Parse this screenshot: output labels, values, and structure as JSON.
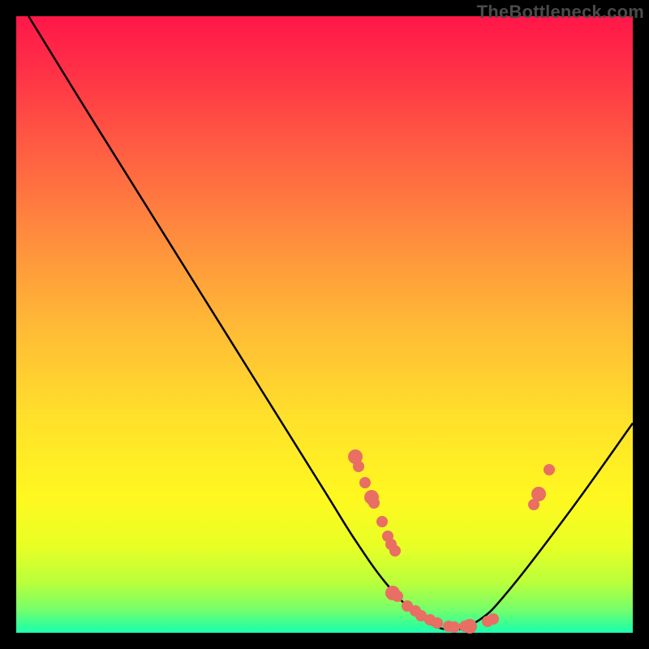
{
  "watermark_text": "TheBottleneck.com",
  "colors": {
    "background": "#000000",
    "watermark": "#4a4a4a",
    "marker": "#e96e63",
    "curve": "#000000",
    "gradient_top": "#ff1749",
    "gradient_bottom": "#1effb8"
  },
  "chart_data": {
    "type": "line",
    "title": "",
    "xlabel": "",
    "ylabel": "",
    "xlim": [
      0,
      100
    ],
    "ylim": [
      0,
      100
    ],
    "series": [
      {
        "name": "bottleneck-curve",
        "x": [
          2,
          10,
          20,
          30,
          40,
          50,
          55,
          60,
          65,
          70,
          75,
          80,
          90,
          100
        ],
        "y": [
          100,
          87,
          71,
          55,
          39,
          23,
          15,
          8,
          3,
          0.5,
          2,
          7,
          20,
          34
        ]
      }
    ],
    "markers": [
      {
        "x": 55.0,
        "y": 28.5
      },
      {
        "x": 55.5,
        "y": 27.0
      },
      {
        "x": 56.6,
        "y": 24.3
      },
      {
        "x": 57.6,
        "y": 22.0
      },
      {
        "x": 58.0,
        "y": 21.0
      },
      {
        "x": 59.3,
        "y": 18.0
      },
      {
        "x": 60.3,
        "y": 15.7
      },
      {
        "x": 60.8,
        "y": 14.3
      },
      {
        "x": 61.4,
        "y": 13.3
      },
      {
        "x": 61.1,
        "y": 6.5
      },
      {
        "x": 61.8,
        "y": 5.9
      },
      {
        "x": 63.4,
        "y": 4.3
      },
      {
        "x": 64.7,
        "y": 3.5
      },
      {
        "x": 65.7,
        "y": 2.8
      },
      {
        "x": 67.1,
        "y": 2.1
      },
      {
        "x": 68.3,
        "y": 1.6
      },
      {
        "x": 70.1,
        "y": 1.1
      },
      {
        "x": 71.1,
        "y": 0.9
      },
      {
        "x": 72.7,
        "y": 1.0
      },
      {
        "x": 73.5,
        "y": 1.1
      },
      {
        "x": 76.5,
        "y": 1.8
      },
      {
        "x": 77.4,
        "y": 2.3
      },
      {
        "x": 84.0,
        "y": 20.8
      },
      {
        "x": 84.8,
        "y": 22.5
      },
      {
        "x": 86.4,
        "y": 26.4
      }
    ]
  }
}
